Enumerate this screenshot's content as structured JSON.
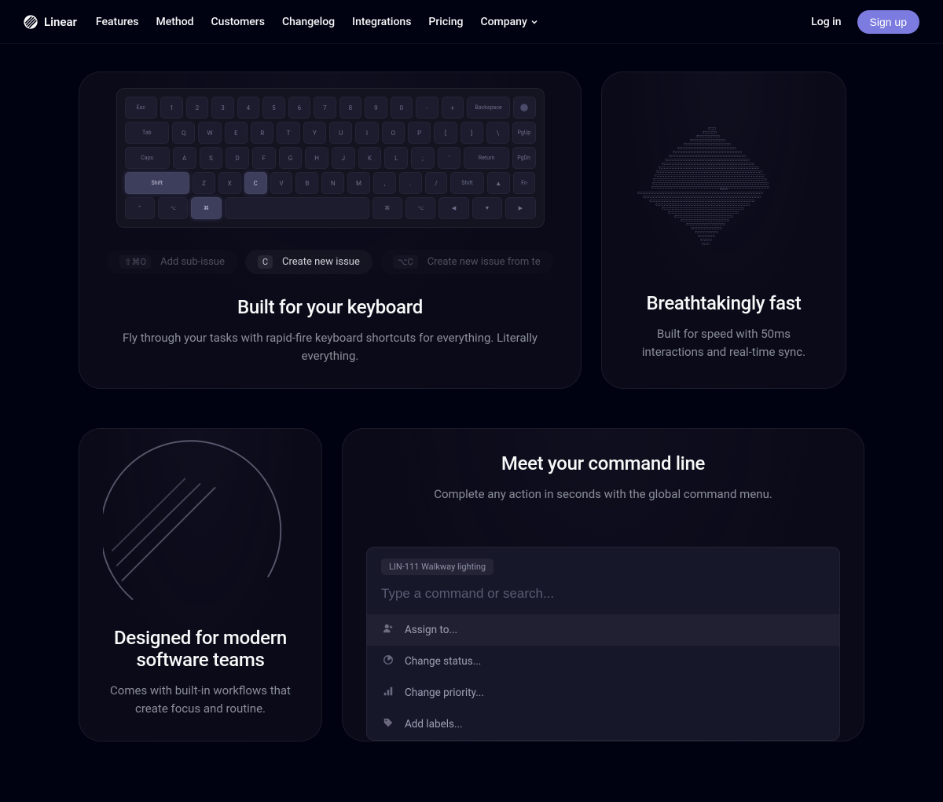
{
  "brand": "Linear",
  "nav": {
    "features": "Features",
    "method": "Method",
    "customers": "Customers",
    "changelog": "Changelog",
    "integrations": "Integrations",
    "pricing": "Pricing",
    "company": "Company"
  },
  "auth": {
    "login": "Log in",
    "signup": "Sign up"
  },
  "keyboard": {
    "row1": [
      "Esc",
      "1",
      "2",
      "3",
      "4",
      "5",
      "6",
      "7",
      "8",
      "9",
      "0",
      "-",
      "+",
      "Backspace",
      ""
    ],
    "row2": [
      "Tab",
      "Q",
      "W",
      "E",
      "R",
      "T",
      "Y",
      "U",
      "I",
      "O",
      "P",
      "[",
      "]",
      "\\",
      "PgUp"
    ],
    "row3": [
      "Caps",
      "A",
      "S",
      "D",
      "F",
      "G",
      "H",
      "J",
      "K",
      "L",
      ";",
      "'",
      "Return",
      "PgDn"
    ],
    "row4": [
      "Shift",
      "Z",
      "X",
      "C",
      "V",
      "B",
      "N",
      "M",
      ",",
      ".",
      "/",
      "Shift",
      "▲",
      "Fn"
    ],
    "row5": [
      "⌃",
      "⌥",
      "⌘",
      "",
      "⌘",
      "⌥",
      "◀",
      "▼",
      "▶"
    ]
  },
  "shortcuts": [
    {
      "key": "⇧⌘O",
      "label": "Add sub-issue",
      "faded": true
    },
    {
      "key": "C",
      "label": "Create new issue",
      "faded": false
    },
    {
      "key": "⌥C",
      "label": "Create new issue from te",
      "faded": true
    }
  ],
  "card_keyboard": {
    "title": "Built for your keyboard",
    "desc": "Fly through your tasks with rapid-fire keyboard shortcuts for everything. Literally everything."
  },
  "card_fast": {
    "title": "Breathtakingly fast",
    "desc": "Built for speed with 50ms interactions and real-time sync."
  },
  "card_teams": {
    "title": "Designed for modern software teams",
    "desc": "Comes with built-in workflows that create focus and routine."
  },
  "card_command": {
    "title": "Meet your command line",
    "desc": "Complete any action in seconds with the global command menu.",
    "tag": "LIN-111 Walkway lighting",
    "placeholder": "Type a command or search...",
    "items": [
      {
        "icon": "assign",
        "label": "Assign to...",
        "selected": true
      },
      {
        "icon": "status",
        "label": "Change status...",
        "selected": false
      },
      {
        "icon": "priority",
        "label": "Change priority...",
        "selected": false
      },
      {
        "icon": "labels",
        "label": "Add labels...",
        "selected": false
      }
    ]
  }
}
